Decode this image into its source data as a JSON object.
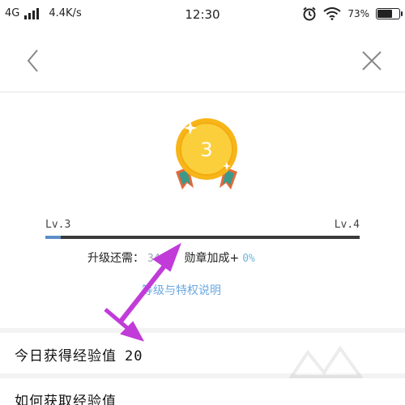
{
  "status_bar": {
    "network": "4G",
    "speed": "4.4K/s",
    "time": "12:30",
    "battery": "73%",
    "battery_level": 0.73
  },
  "nav": {
    "back_icon": "chevron-left-icon",
    "close_icon": "close-icon"
  },
  "medal": {
    "number": "3",
    "color": "#f5c026"
  },
  "level": {
    "current": "Lv.3",
    "next": "Lv.4",
    "progress": 0.05,
    "progress_color": "#5b8fc9"
  },
  "upgrade": {
    "prefix": "升级还需：",
    "points": "340",
    "separator": "，",
    "bonus_label": "勋章加成+",
    "bonus_value": "0%"
  },
  "links": {
    "explain": "等级与特权说明"
  },
  "rows": {
    "today_label": "今日获得经验值",
    "today_value": "20",
    "next_label": "如何获取经验值"
  },
  "annotation": {
    "arrow_color": "#c13bd9"
  }
}
